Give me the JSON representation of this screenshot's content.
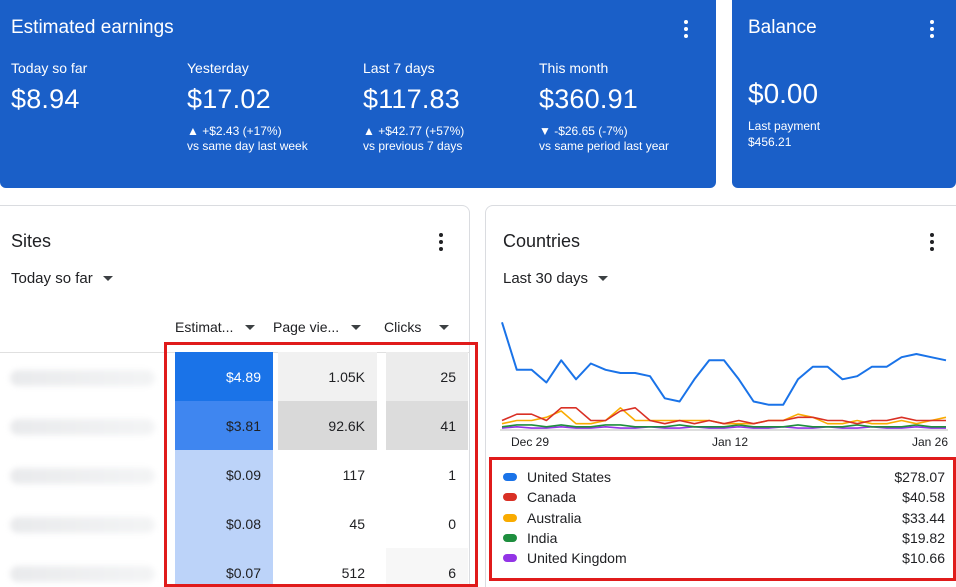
{
  "earnings": {
    "title": "Estimated earnings",
    "metrics": [
      {
        "label": "Today so far",
        "value": "$8.94",
        "change": "",
        "note": ""
      },
      {
        "label": "Yesterday",
        "value": "$17.02",
        "change": "▲ +$2.43 (+17%)",
        "note": "vs same day last week"
      },
      {
        "label": "Last 7 days",
        "value": "$117.83",
        "change": "▲ +$42.77 (+57%)",
        "note": "vs previous 7 days"
      },
      {
        "label": "This month",
        "value": "$360.91",
        "change": "▼ -$26.65 (-7%)",
        "note": "vs same period last year"
      }
    ]
  },
  "balance": {
    "title": "Balance",
    "value": "$0.00",
    "last_payment_label": "Last payment",
    "last_payment_amount": "$456.21"
  },
  "sites": {
    "title": "Sites",
    "period": "Today so far",
    "columns": [
      "Estimat...",
      "Page vie...",
      "Clicks"
    ],
    "rows": [
      {
        "earnings": "$4.89",
        "pageviews": "1.05K",
        "clicks": "25"
      },
      {
        "earnings": "$3.81",
        "pageviews": "92.6K",
        "clicks": "41"
      },
      {
        "earnings": "$0.09",
        "pageviews": "117",
        "clicks": "1"
      },
      {
        "earnings": "$0.08",
        "pageviews": "45",
        "clicks": "0"
      },
      {
        "earnings": "$0.07",
        "pageviews": "512",
        "clicks": "6"
      }
    ]
  },
  "countries": {
    "title": "Countries",
    "period": "Last 30 days",
    "x_ticks": [
      "Dec 29",
      "Jan 12",
      "Jan 26"
    ],
    "legend": [
      {
        "name": "United States",
        "value": "$278.07",
        "color": "#1a73e8"
      },
      {
        "name": "Canada",
        "value": "$40.58",
        "color": "#d93025"
      },
      {
        "name": "Australia",
        "value": "$33.44",
        "color": "#f9ab00"
      },
      {
        "name": "India",
        "value": "$19.82",
        "color": "#1e8e3e"
      },
      {
        "name": "United Kingdom",
        "value": "$10.66",
        "color": "#9334e6"
      }
    ]
  },
  "chart_data": {
    "type": "line",
    "x_ticks": [
      "Dec 29",
      "Jan 12",
      "Jan 26"
    ],
    "series": [
      {
        "name": "United States",
        "color": "#1a73e8",
        "values": [
          17,
          9.5,
          9.5,
          7.5,
          11,
          8,
          10.5,
          9.5,
          9,
          9,
          8.5,
          5,
          4.5,
          8,
          11,
          11,
          8,
          4.5,
          4,
          4,
          8,
          10,
          10,
          8,
          8.5,
          10,
          10,
          11.5,
          12,
          11.5,
          11
        ]
      },
      {
        "name": "Canada",
        "color": "#d93025",
        "values": [
          1.5,
          2.5,
          2.5,
          1.5,
          3.5,
          3.5,
          1.5,
          1.5,
          3,
          3.5,
          1.5,
          1,
          1.5,
          1,
          1.5,
          1,
          1.5,
          1,
          1.5,
          1.5,
          2,
          2,
          1.5,
          1.5,
          1,
          1.5,
          1.5,
          2,
          1.5,
          1.5,
          1.5
        ]
      },
      {
        "name": "Australia",
        "color": "#f9ab00",
        "values": [
          1,
          1.5,
          1.5,
          2,
          3,
          1,
          1,
          1.5,
          3.5,
          1.5,
          1.5,
          1.5,
          1.5,
          1.5,
          1.5,
          1,
          1,
          1,
          1.5,
          1.5,
          2.5,
          2,
          1,
          1,
          1.5,
          1,
          1,
          1.5,
          1,
          1.5,
          2
        ]
      },
      {
        "name": "India",
        "color": "#1e8e3e",
        "values": [
          0.5,
          0.8,
          0.8,
          0.5,
          0.8,
          0.5,
          0.5,
          0.8,
          0.8,
          0.5,
          0.5,
          0.5,
          0.8,
          0.5,
          0.5,
          0.5,
          0.8,
          0.5,
          0.5,
          0.5,
          0.8,
          0.5,
          0.5,
          0.5,
          0.8,
          0.5,
          0.5,
          0.5,
          0.8,
          0.5,
          0.5
        ]
      },
      {
        "name": "United Kingdom",
        "color": "#9334e6",
        "values": [
          0.3,
          0.5,
          0.3,
          0.3,
          0.5,
          0.3,
          0.3,
          0.5,
          0.3,
          0.3,
          0.5,
          0.3,
          0.3,
          0.5,
          0.3,
          0.3,
          0.5,
          0.3,
          0.3,
          0.5,
          0.3,
          0.3,
          0.5,
          0.3,
          0.3,
          0.5,
          0.3,
          0.3,
          0.5,
          0.3,
          0.3
        ]
      }
    ],
    "ylim": [
      0,
      18
    ],
    "grid": false,
    "legend": "below"
  }
}
